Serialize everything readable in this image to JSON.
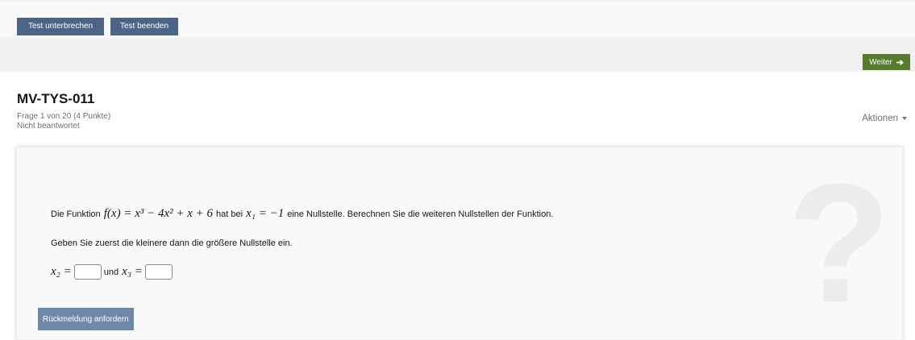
{
  "toolbar": {
    "pause_label": "Test unterbrechen",
    "finish_label": "Test beenden",
    "next_label": "Weiter",
    "next_icon": "arrow-right-icon"
  },
  "question": {
    "title": "MV-TYS-011",
    "progress": "Frage 1 von 20 (4 Punkte)",
    "status": "Nicht beantwortet",
    "actions_label": "Aktionen",
    "text_prefix": "Die Funktion",
    "function": "f(x) = x³ − 4x² + x + 6",
    "text_middle": "hat bei",
    "root_given": "x₁ = −1",
    "text_suffix": "eine Nullstelle. Berechnen Sie die weiteren Nullstellen der Funktion.",
    "hint": "Geben Sie zuerst die kleinere dann die größere Nullstelle ein.",
    "x2_label": "x₂ =",
    "and_label": "und",
    "x3_label": "x₃ =",
    "x2_value": "",
    "x3_value": "",
    "feedback_label": "Rückmeldung anfordern",
    "watermark_icon": "question-mark-icon"
  },
  "colors": {
    "primary_button": "#4c6586",
    "next_button": "#557b2e",
    "feedback_button": "#6f89ac"
  }
}
